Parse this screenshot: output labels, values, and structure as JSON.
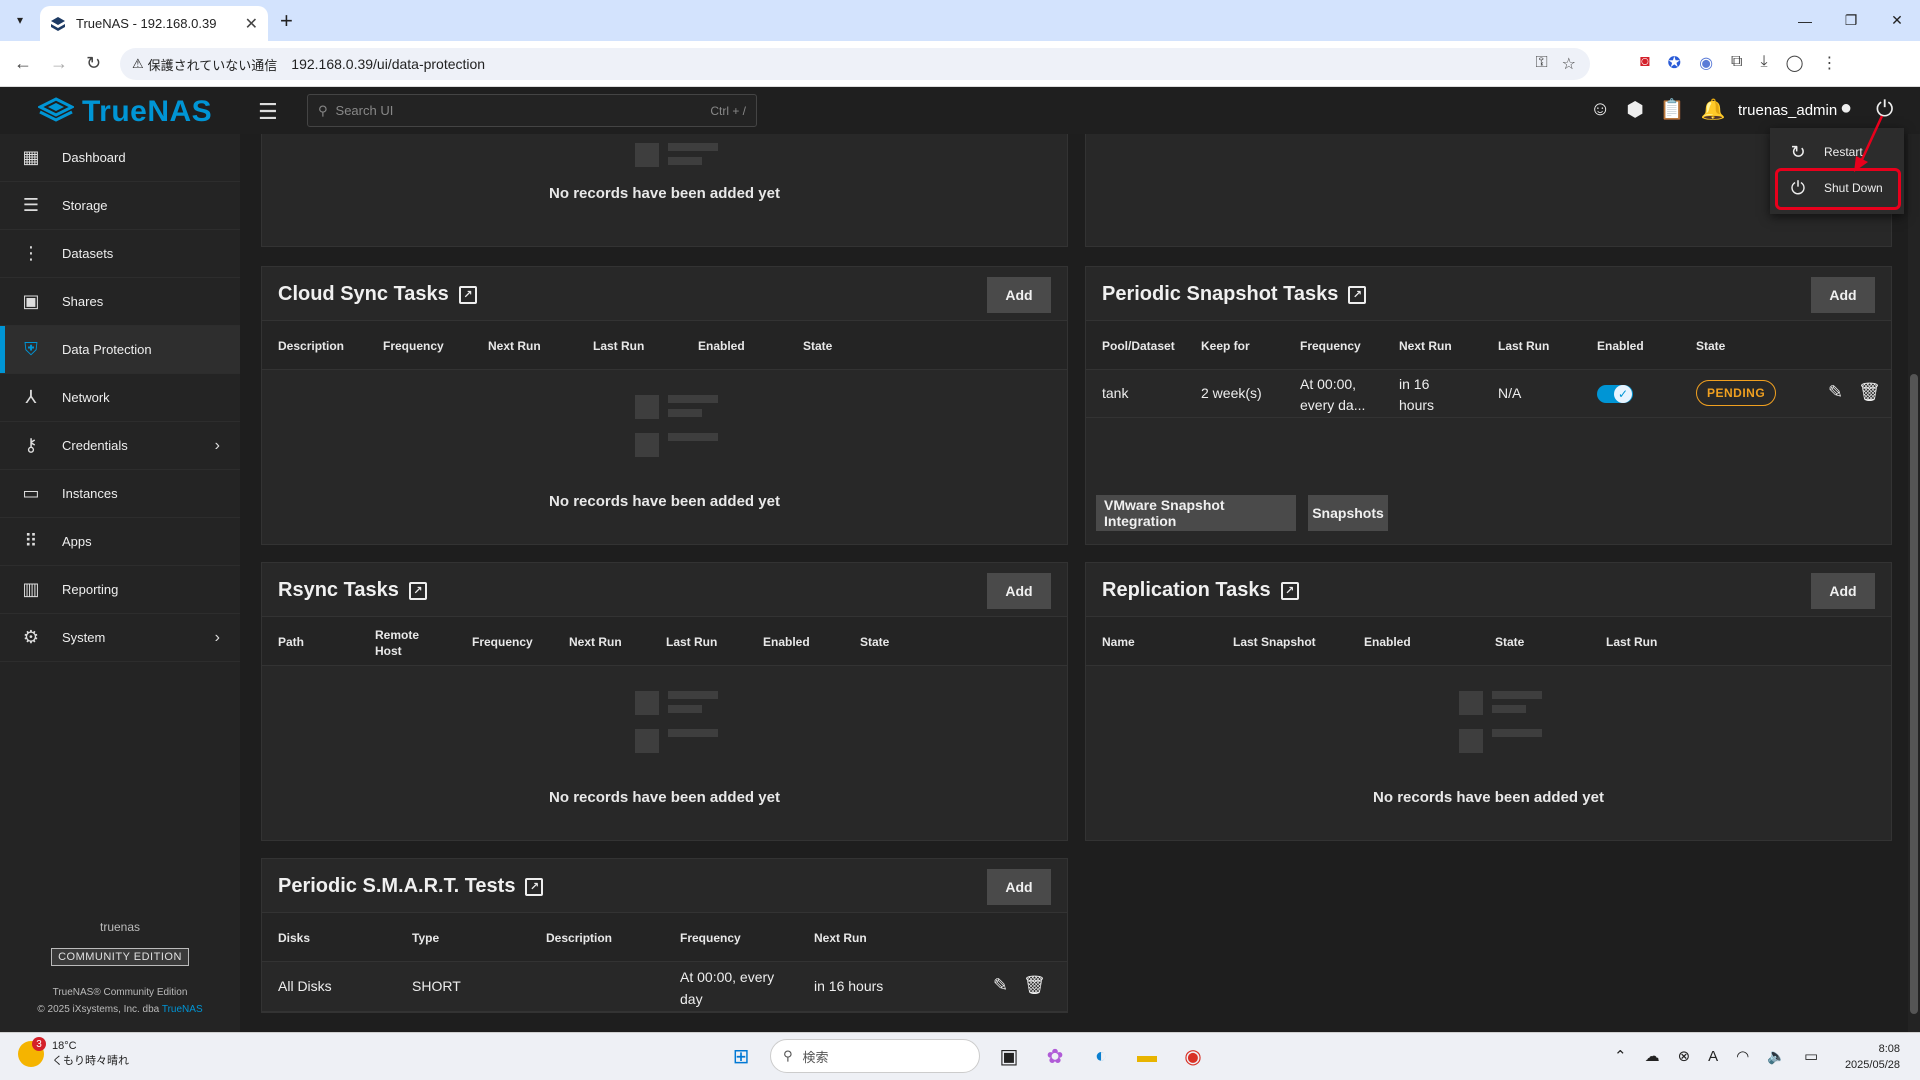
{
  "browser": {
    "tab_title": "TrueNAS - 192.168.0.39",
    "security_warning": "保護されていない通信",
    "url": "192.168.0.39/ui/data-protection"
  },
  "topbar": {
    "brand": "TrueNAS",
    "search_placeholder": "Search UI",
    "search_shortcut": "Ctrl + /",
    "username": "truenas_admin"
  },
  "sidebar": {
    "items": [
      {
        "label": "Dashboard",
        "icon": "dashboard-icon"
      },
      {
        "label": "Storage",
        "icon": "storage-icon"
      },
      {
        "label": "Datasets",
        "icon": "datasets-icon"
      },
      {
        "label": "Shares",
        "icon": "shares-icon"
      },
      {
        "label": "Data Protection",
        "icon": "shield-icon"
      },
      {
        "label": "Network",
        "icon": "network-icon"
      },
      {
        "label": "Credentials",
        "icon": "key-icon"
      },
      {
        "label": "Instances",
        "icon": "laptop-icon"
      },
      {
        "label": "Apps",
        "icon": "apps-grid-icon"
      },
      {
        "label": "Reporting",
        "icon": "reporting-icon"
      },
      {
        "label": "System",
        "icon": "gear-icon"
      }
    ],
    "hostname": "truenas",
    "edition": "COMMUNITY EDITION",
    "copyright_line1": "TrueNAS® Community Edition",
    "copyright_line2": "© 2025 iXsystems, Inc. dba",
    "copyright_link": "TrueNAS"
  },
  "empty_text": "No records have been added yet",
  "add_label": "Add",
  "cloud_sync": {
    "title": "Cloud Sync Tasks",
    "columns": [
      "Description",
      "Frequency",
      "Next Run",
      "Last Run",
      "Enabled",
      "State"
    ]
  },
  "periodic_snapshot": {
    "title": "Periodic Snapshot Tasks",
    "columns": [
      "Pool/Dataset",
      "Keep for",
      "Frequency",
      "Next Run",
      "Last Run",
      "Enabled",
      "State"
    ],
    "rows": [
      {
        "dataset": "tank",
        "keep_for": "2 week(s)",
        "frequency_l1": "At 00:00,",
        "frequency_l2": "every da...",
        "next_run_l1": "in 16",
        "next_run_l2": "hours",
        "last_run": "N/A",
        "enabled": true,
        "state": "PENDING"
      }
    ],
    "btn_vmware": "VMware Snapshot Integration",
    "btn_snapshots": "Snapshots"
  },
  "rsync": {
    "title": "Rsync Tasks",
    "columns": [
      "Path",
      "Remote Host",
      "Frequency",
      "Next Run",
      "Last Run",
      "Enabled",
      "State"
    ],
    "remote_l1": "Remote",
    "remote_l2": "Host"
  },
  "replication": {
    "title": "Replication Tasks",
    "columns": [
      "Name",
      "Last Snapshot",
      "Enabled",
      "State",
      "Last Run"
    ]
  },
  "smart": {
    "title": "Periodic S.M.A.R.T. Tests",
    "columns": [
      "Disks",
      "Type",
      "Description",
      "Frequency",
      "Next Run"
    ],
    "rows": [
      {
        "disks": "All Disks",
        "type": "SHORT",
        "description": "",
        "frequency_l1": "At 00:00, every",
        "frequency_l2": "day",
        "next_run": "in 16 hours"
      }
    ]
  },
  "power_menu": {
    "restart": "Restart",
    "shutdown": "Shut Down"
  },
  "taskbar": {
    "weather_temp": "18°C",
    "weather_desc": "くもり時々晴れ",
    "weather_badge": "3",
    "search_placeholder": "検索",
    "time": "8:08",
    "date": "2025/05/28"
  },
  "colors": {
    "accent": "#0095d5",
    "pending": "#f0a020",
    "highlight": "#e8001c"
  }
}
